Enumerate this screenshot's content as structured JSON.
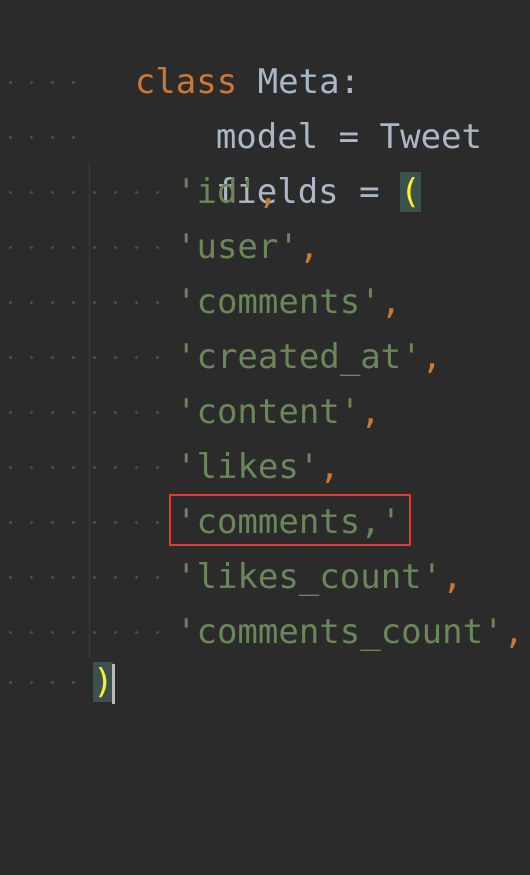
{
  "code": {
    "class_keyword": "class",
    "class_name": "Meta",
    "class_colon": ":",
    "model_line": {
      "name": "model",
      "op": "=",
      "value": "Tweet"
    },
    "fields_line": {
      "name": "fields",
      "op": "=",
      "open_paren": "("
    },
    "field_items": [
      {
        "text": "'id'",
        "suffix": ","
      },
      {
        "text": "'user'",
        "suffix": ","
      },
      {
        "text": "'comments'",
        "suffix": ","
      },
      {
        "text": "'created_at'",
        "suffix": ","
      },
      {
        "text": "'content'",
        "suffix": ","
      },
      {
        "text": "'likes'",
        "suffix": ","
      },
      {
        "text": "'comments,'",
        "suffix": ""
      },
      {
        "text": "'likes_count'",
        "suffix": ","
      },
      {
        "text": "'comments_count'",
        "suffix": ","
      }
    ],
    "close_paren": ")"
  },
  "colors": {
    "background": "#2b2b2b",
    "keyword": "#cc7832",
    "identifier": "#a9b7c6",
    "string": "#6a8759",
    "matched_paren": "#ffef28",
    "matched_paren_bg": "#3b514d",
    "annotation_box": "#e53935"
  }
}
